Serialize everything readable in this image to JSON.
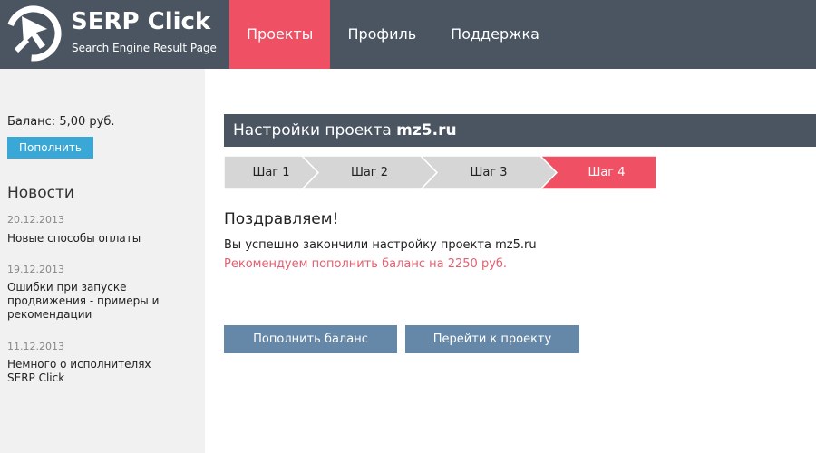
{
  "app": {
    "title": "SERP Click",
    "subtitle": "Search Engine Result Page"
  },
  "nav": {
    "items": [
      {
        "label": "Проекты",
        "active": true
      },
      {
        "label": "Профиль",
        "active": false
      },
      {
        "label": "Поддержка",
        "active": false
      }
    ]
  },
  "sidebar": {
    "balance_text": "Баланс:  5,00 руб.",
    "topup_label": "Пополнить",
    "news_title": "Новости",
    "news": [
      {
        "date": "20.12.2013",
        "text": "Новые способы оплаты"
      },
      {
        "date": "19.12.2013",
        "text": "Ошибки при запуске продвижения - примеры и рекомендации"
      },
      {
        "date": "11.12.2013",
        "text": "Немного о исполнителях SERP Click"
      }
    ]
  },
  "main": {
    "title_prefix": "Настройки проекта ",
    "project_name": "mz5.ru",
    "steps": [
      "Шаг 1",
      "Шаг 2",
      "Шаг 3",
      "Шаг 4"
    ],
    "active_step": 4,
    "congrats": "Поздравляем!",
    "success_text": "Вы успешно закончили настройку проекта mz5.ru",
    "recommend_text": "Рекомендуем пополнить баланс на 2250 руб.",
    "btn_topup": "Пополнить баланс",
    "btn_project": "Перейти к проекту"
  },
  "colors": {
    "header": "#4a5561",
    "accent": "#f05064",
    "sidebar_button": "#3aa8d6",
    "main_button": "#6688a8",
    "step_inactive": "#d6d6d6",
    "recommend": "#e36070"
  },
  "icons": {
    "logo": "cursor-sickle-logo-icon"
  }
}
